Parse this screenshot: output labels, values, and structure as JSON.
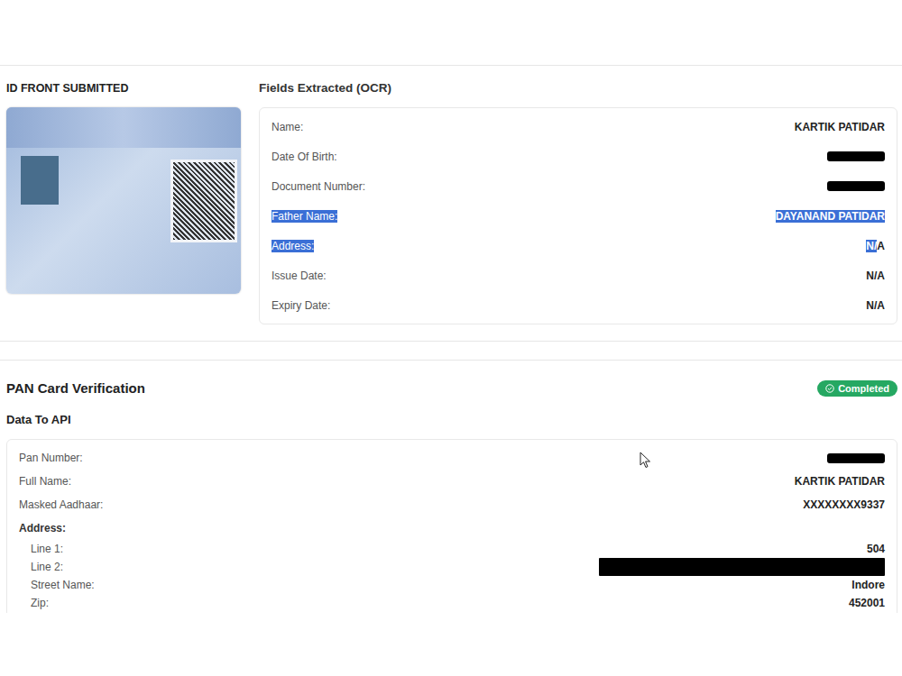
{
  "id_section": {
    "title": "ID FRONT SUBMITTED"
  },
  "ocr": {
    "title": "Fields Extracted (OCR)",
    "fields": [
      {
        "label": "Name:",
        "label_selected": false,
        "redacted": false,
        "value_parts": [
          {
            "text": "KARTIK PATIDAR",
            "selected": false
          }
        ]
      },
      {
        "label": "Date Of Birth:",
        "label_selected": false,
        "redacted": true,
        "value_parts": []
      },
      {
        "label": "Document Number:",
        "label_selected": false,
        "redacted": true,
        "value_parts": []
      },
      {
        "label": "Father Name:",
        "label_selected": true,
        "redacted": false,
        "value_parts": [
          {
            "text": "DAYANAND PATIDAR",
            "selected": true
          }
        ]
      },
      {
        "label": "Address:",
        "label_selected": true,
        "redacted": false,
        "value_parts": [
          {
            "text": "N/",
            "selected": true
          },
          {
            "text": "A",
            "selected": false
          }
        ]
      },
      {
        "label": "Issue Date:",
        "label_selected": false,
        "redacted": false,
        "value_parts": [
          {
            "text": "N/A",
            "selected": false
          }
        ]
      },
      {
        "label": "Expiry Date:",
        "label_selected": false,
        "redacted": false,
        "value_parts": [
          {
            "text": "N/A",
            "selected": false
          }
        ]
      }
    ]
  },
  "verification": {
    "title": "PAN Card Verification",
    "status": {
      "label": "Completed"
    },
    "subtitle": "Data To API",
    "fields": [
      {
        "label": "Pan Number:",
        "redacted": true,
        "value": ""
      },
      {
        "label": "Full Name:",
        "redacted": false,
        "value": "KARTIK PATIDAR"
      },
      {
        "label": "Masked Aadhaar:",
        "redacted": false,
        "value": "XXXXXXXX9337"
      }
    ],
    "address": {
      "label": "Address:",
      "lines": [
        {
          "label": "Line 1:",
          "redacted": false,
          "value": "504"
        },
        {
          "label": "Line 2:",
          "redacted": true,
          "value": ""
        },
        {
          "label": "Street Name:",
          "redacted": false,
          "value": "Indore"
        },
        {
          "label": "Zip:",
          "redacted": false,
          "value": "452001"
        }
      ]
    }
  }
}
